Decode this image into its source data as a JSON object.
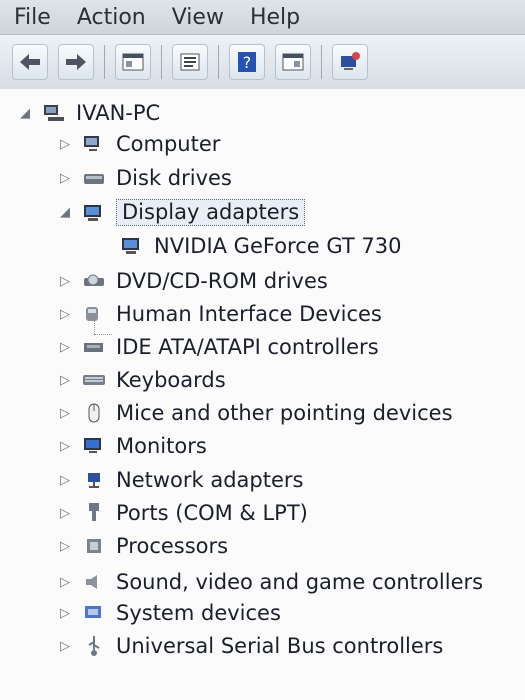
{
  "menu": {
    "file": "File",
    "action": "Action",
    "view": "View",
    "help": "Help"
  },
  "toolbar": {
    "buttons": [
      "back",
      "forward",
      "show-hide-console-tree",
      "properties",
      "help",
      "show-hide-action-pane",
      "scan-for-hardware"
    ]
  },
  "tree": {
    "root": "IVAN-PC",
    "items": [
      "Computer",
      "Disk drives",
      "Display adapters",
      "NVIDIA GeForce GT 730",
      "DVD/CD-ROM drives",
      "Human Interface Devices",
      "IDE ATA/ATAPI controllers",
      "Keyboards",
      "Mice and other pointing devices",
      "Monitors",
      "Network adapters",
      "Ports (COM & LPT)",
      "Processors",
      "Sound, video and game controllers",
      "System devices",
      "Universal Serial Bus controllers"
    ]
  }
}
